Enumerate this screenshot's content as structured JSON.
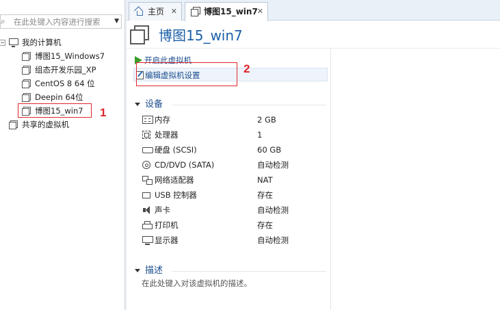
{
  "search": {
    "placeholder": "在此处键入内容进行搜索"
  },
  "tree": {
    "root_label": "我的计算机",
    "vms": [
      "博图15_Windows7",
      "组态开发乐园_XP",
      "CentOS 8 64 位",
      "Deepin 64位",
      "博图15_win7"
    ],
    "shared_label": "共享的虚拟机"
  },
  "tabs": [
    {
      "label": "主页"
    },
    {
      "label": "博图15_win7"
    }
  ],
  "vm": {
    "title": "博图15_win7",
    "actions": {
      "start": "开启此虚拟机",
      "edit": "编辑虚拟机设置"
    }
  },
  "devices": {
    "header": "设备",
    "rows": [
      {
        "name": "内存",
        "value": "2 GB",
        "icon": "memory-icon"
      },
      {
        "name": "处理器",
        "value": "1",
        "icon": "cpu-icon"
      },
      {
        "name": "硬盘 (SCSI)",
        "value": "60 GB",
        "icon": "hard-disk-icon"
      },
      {
        "name": "CD/DVD (SATA)",
        "value": "自动检测",
        "icon": "cd-dvd-icon"
      },
      {
        "name": "网络适配器",
        "value": "NAT",
        "icon": "network-adapter-icon"
      },
      {
        "name": "USB 控制器",
        "value": "存在",
        "icon": "usb-controller-icon"
      },
      {
        "name": "声卡",
        "value": "自动检测",
        "icon": "sound-card-icon"
      },
      {
        "name": "打印机",
        "value": "存在",
        "icon": "printer-icon"
      },
      {
        "name": "显示器",
        "value": "自动检测",
        "icon": "display-icon"
      }
    ]
  },
  "description": {
    "header": "描述",
    "placeholder": "在此处键入对该虚拟机的描述。"
  },
  "annotations": {
    "one": "1",
    "two": "2",
    "color": "#e0252b"
  },
  "colors": {
    "accent": "#1a5fa8",
    "link": "#1a4d8c",
    "play": "#3a9a2a"
  }
}
